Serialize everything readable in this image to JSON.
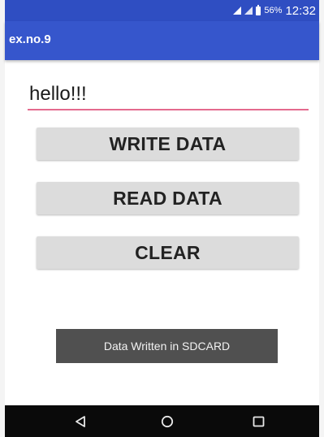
{
  "status_bar": {
    "battery_percent": "56%",
    "time": "12:32",
    "background_color": "#2f4ec2",
    "icons": [
      "signal-icon",
      "signal-icon",
      "battery-icon"
    ]
  },
  "app_bar": {
    "title": "ex.no.9",
    "background_color": "#3656cc"
  },
  "input": {
    "value": "hello!!!",
    "underline_color": "#e46a8e"
  },
  "buttons": {
    "write_label": "WRITE DATA",
    "read_label": "READ DATA",
    "clear_label": "CLEAR"
  },
  "toast": {
    "message": "Data Written in SDCARD"
  },
  "nav_bar": {
    "icons": [
      "back-icon",
      "home-icon",
      "recent-apps-icon"
    ]
  }
}
